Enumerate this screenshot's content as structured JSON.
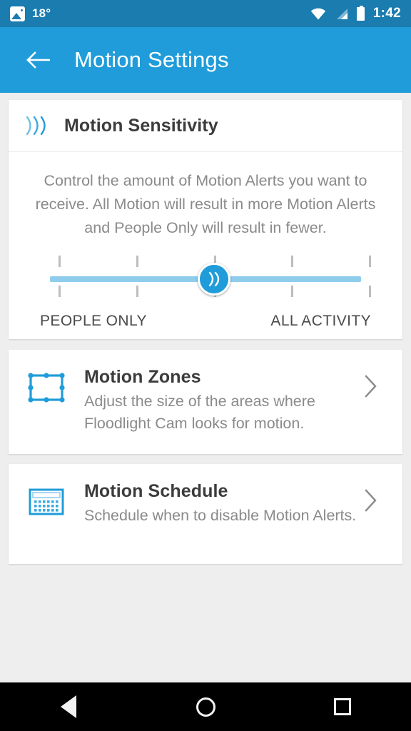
{
  "status_bar": {
    "photo_icon": "image-icon",
    "temperature": "18°",
    "wifi_icon": "wifi-icon",
    "signal_icon": "cell-signal-icon",
    "battery_icon": "battery-icon",
    "time": "1:42",
    "background_color": "#1b7cb0"
  },
  "app_bar": {
    "back_icon": "back-arrow-icon",
    "title": "Motion Settings",
    "background_color": "#1f9cd9"
  },
  "sensitivity_card": {
    "icon": "motion-waves-icon",
    "title": "Motion Sensitivity",
    "description": "Control the amount of Motion Alerts you want to receive. All Motion will result in more Motion Alerts and People Only will result in fewer.",
    "slider": {
      "icon": "motion-chevrons-icon",
      "steps": 5,
      "value": 3,
      "min_label": "PEOPLE ONLY",
      "max_label": "ALL ACTIVITY",
      "track_color": "#8ecdec",
      "thumb_color": "#1f9cd9"
    }
  },
  "list_items": [
    {
      "icon": "motion-zones-rectangle-icon",
      "title": "Motion Zones",
      "subtitle": "Adjust the size of the areas where Floodlight Cam looks for motion.",
      "chevron": "chevron-right-icon"
    },
    {
      "icon": "calendar-icon",
      "title": "Motion Schedule",
      "subtitle": "Schedule when to disable Motion Alerts.",
      "chevron": "chevron-right-icon"
    }
  ],
  "nav_bar": {
    "back": "nav-back-icon",
    "home": "nav-home-icon",
    "recents": "nav-recents-icon"
  },
  "theme": {
    "accent": "#1f9cd9",
    "page_background": "#eeeeee",
    "card_background": "#ffffff",
    "title_color": "#3c3c3c",
    "body_color": "#8a8a8a"
  }
}
